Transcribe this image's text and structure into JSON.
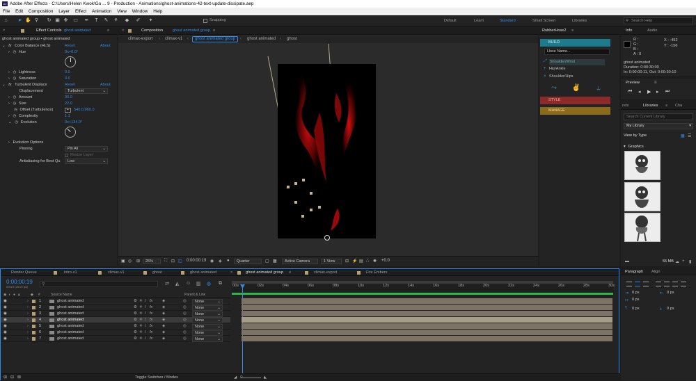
{
  "titlebar": {
    "logo": "Ae",
    "title": "Adobe After Effects - C:\\Users\\Helen Kwok\\Go ... 9 - Production - Animations\\ghost-animations-42-text-update-dissipate.aep"
  },
  "menu": [
    "File",
    "Edit",
    "Composition",
    "Layer",
    "Effect",
    "Animation",
    "View",
    "Window",
    "Help"
  ],
  "toolbar": {
    "snapping": "Snapping",
    "workspaces": [
      "Default",
      "Learn",
      "Standard",
      "Small Screen",
      "Libraries"
    ],
    "active_workspace": "Standard",
    "search_placeholder": "Search Help"
  },
  "effect_controls": {
    "tab": "Effect Controls",
    "tab_target": "ghost animated",
    "header": "ghost animated group • ghost animated",
    "reset": "Reset",
    "about": "About",
    "color_balance": {
      "name": "Color Balance (HLS)",
      "hue_label": "Hue",
      "hue_value": "0x+0.0°",
      "lightness_label": "Lightness",
      "lightness_value": "0.0",
      "saturation_label": "Saturation",
      "saturation_value": "0.0"
    },
    "turbulent": {
      "name": "Turbulent Displace",
      "displacement_label": "Displacement",
      "displacement_value": "Turbulent",
      "amount_label": "Amount",
      "amount_value": "90.0",
      "size_label": "Size",
      "size_value": "22.0",
      "offset_label": "Offset (Turbulence)",
      "offset_value": "540.0,960.0",
      "complexity_label": "Complexity",
      "complexity_value": "1.1",
      "evolution_label": "Evolution",
      "evolution_value": "0x+134.0°",
      "evolution_options": "Evolution Options",
      "pinning_label": "Pinning",
      "pinning_value": "Pin All",
      "resize_layer": "Resize Layer",
      "antialias_label": "Antialiasing for Best Qu",
      "antialias_value": "Low"
    }
  },
  "composition": {
    "tab": "Composition",
    "tab_target": "ghost animated group",
    "breadcrumbs": [
      "climax-export",
      "climax-v1",
      "ghost animated group",
      "ghost animated",
      "ghost"
    ],
    "active_breadcrumb": "ghost animated group",
    "footer": {
      "zoom": "25%",
      "timecode": "0:00:00:19",
      "resolution": "Quarter",
      "camera": "Active Camera",
      "view": "1 View",
      "exposure": "+0.0"
    }
  },
  "rubberhose": {
    "title": "RubberHose2",
    "build": "BUILD",
    "hose_name_placeholder": "Hose Name...",
    "items": [
      "Shoulder/Wrist",
      "Hip/Ankle",
      "Shoulder/Hips"
    ],
    "style": "STYLE",
    "manage": "MANAGE"
  },
  "info": {
    "tabs": [
      "Info",
      "Audio"
    ],
    "r": "R :",
    "g": "G :",
    "b": "B :",
    "a": "A : 0",
    "x": "X : -452",
    "y": "Y : -156",
    "layer_name": "ghost animated",
    "duration": "Duration: 0:00:30:00",
    "in_out": "In: 0:00:00:11, Out: 0:00:30:10"
  },
  "preview": {
    "title": "Preview"
  },
  "libraries": {
    "tabs": [
      "rets",
      "Libraries",
      "Cha"
    ],
    "search_placeholder": "Search Current Library",
    "library": "My Library",
    "view_by": "View by Type",
    "section": "Graphics",
    "size": "55 MB"
  },
  "timeline": {
    "tabs": [
      "Render Queue",
      "intro-v1",
      "climax-v1",
      "ghost",
      "ghost animated",
      "ghost animated group",
      "climax-export",
      "Fire Embers"
    ],
    "active_tab": "ghost animated group",
    "timecode": "0:00:00:19",
    "timecode_sub": "00019 (25.00 fps)",
    "col_source": "Source Name",
    "col_parent": "Parent & Link",
    "ruler": [
      "00s",
      "02s",
      "04s",
      "06s",
      "08s",
      "10s",
      "12s",
      "14s",
      "16s",
      "18s",
      "20s",
      "22s",
      "24s",
      "26s",
      "28s",
      "30s"
    ],
    "layers": [
      {
        "num": "1",
        "name": "ghost animated",
        "parent": "None"
      },
      {
        "num": "2",
        "name": "ghost animated",
        "parent": "None"
      },
      {
        "num": "3",
        "name": "ghost animated",
        "parent": "None"
      },
      {
        "num": "4",
        "name": "ghost animated",
        "parent": "None"
      },
      {
        "num": "5",
        "name": "ghost animated",
        "parent": "None"
      },
      {
        "num": "6",
        "name": "ghost animated",
        "parent": "None"
      },
      {
        "num": "7",
        "name": "ghost animated",
        "parent": "None"
      }
    ],
    "toggle_label": "Toggle Switches / Modes"
  },
  "paragraph": {
    "tabs": [
      "Paragraph",
      "Align"
    ],
    "values": [
      "0 px",
      "0 px",
      "0 px",
      "0 px",
      "0 px"
    ]
  },
  "colors": {
    "accent": "#2d8ceb",
    "build": "#1c7b8c",
    "style": "#8c2a2a",
    "manage": "#8c6a1c",
    "layer_bar": "#7d7466"
  }
}
